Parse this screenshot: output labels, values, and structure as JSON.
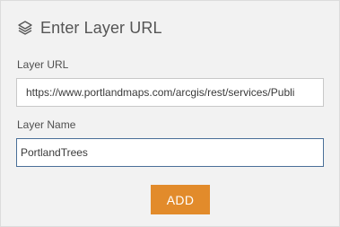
{
  "header": {
    "title": "Enter Layer URL",
    "icon": "layers-icon"
  },
  "form": {
    "url_label": "Layer URL",
    "url_value": "https://www.portlandmaps.com/arcgis/rest/services/Publi",
    "name_label": "Layer Name",
    "name_value": "PortlandTrees",
    "add_label": "ADD"
  },
  "colors": {
    "accent": "#e28b2b",
    "focus_border": "#4a6f98",
    "panel_bg": "#f2f2f2"
  }
}
